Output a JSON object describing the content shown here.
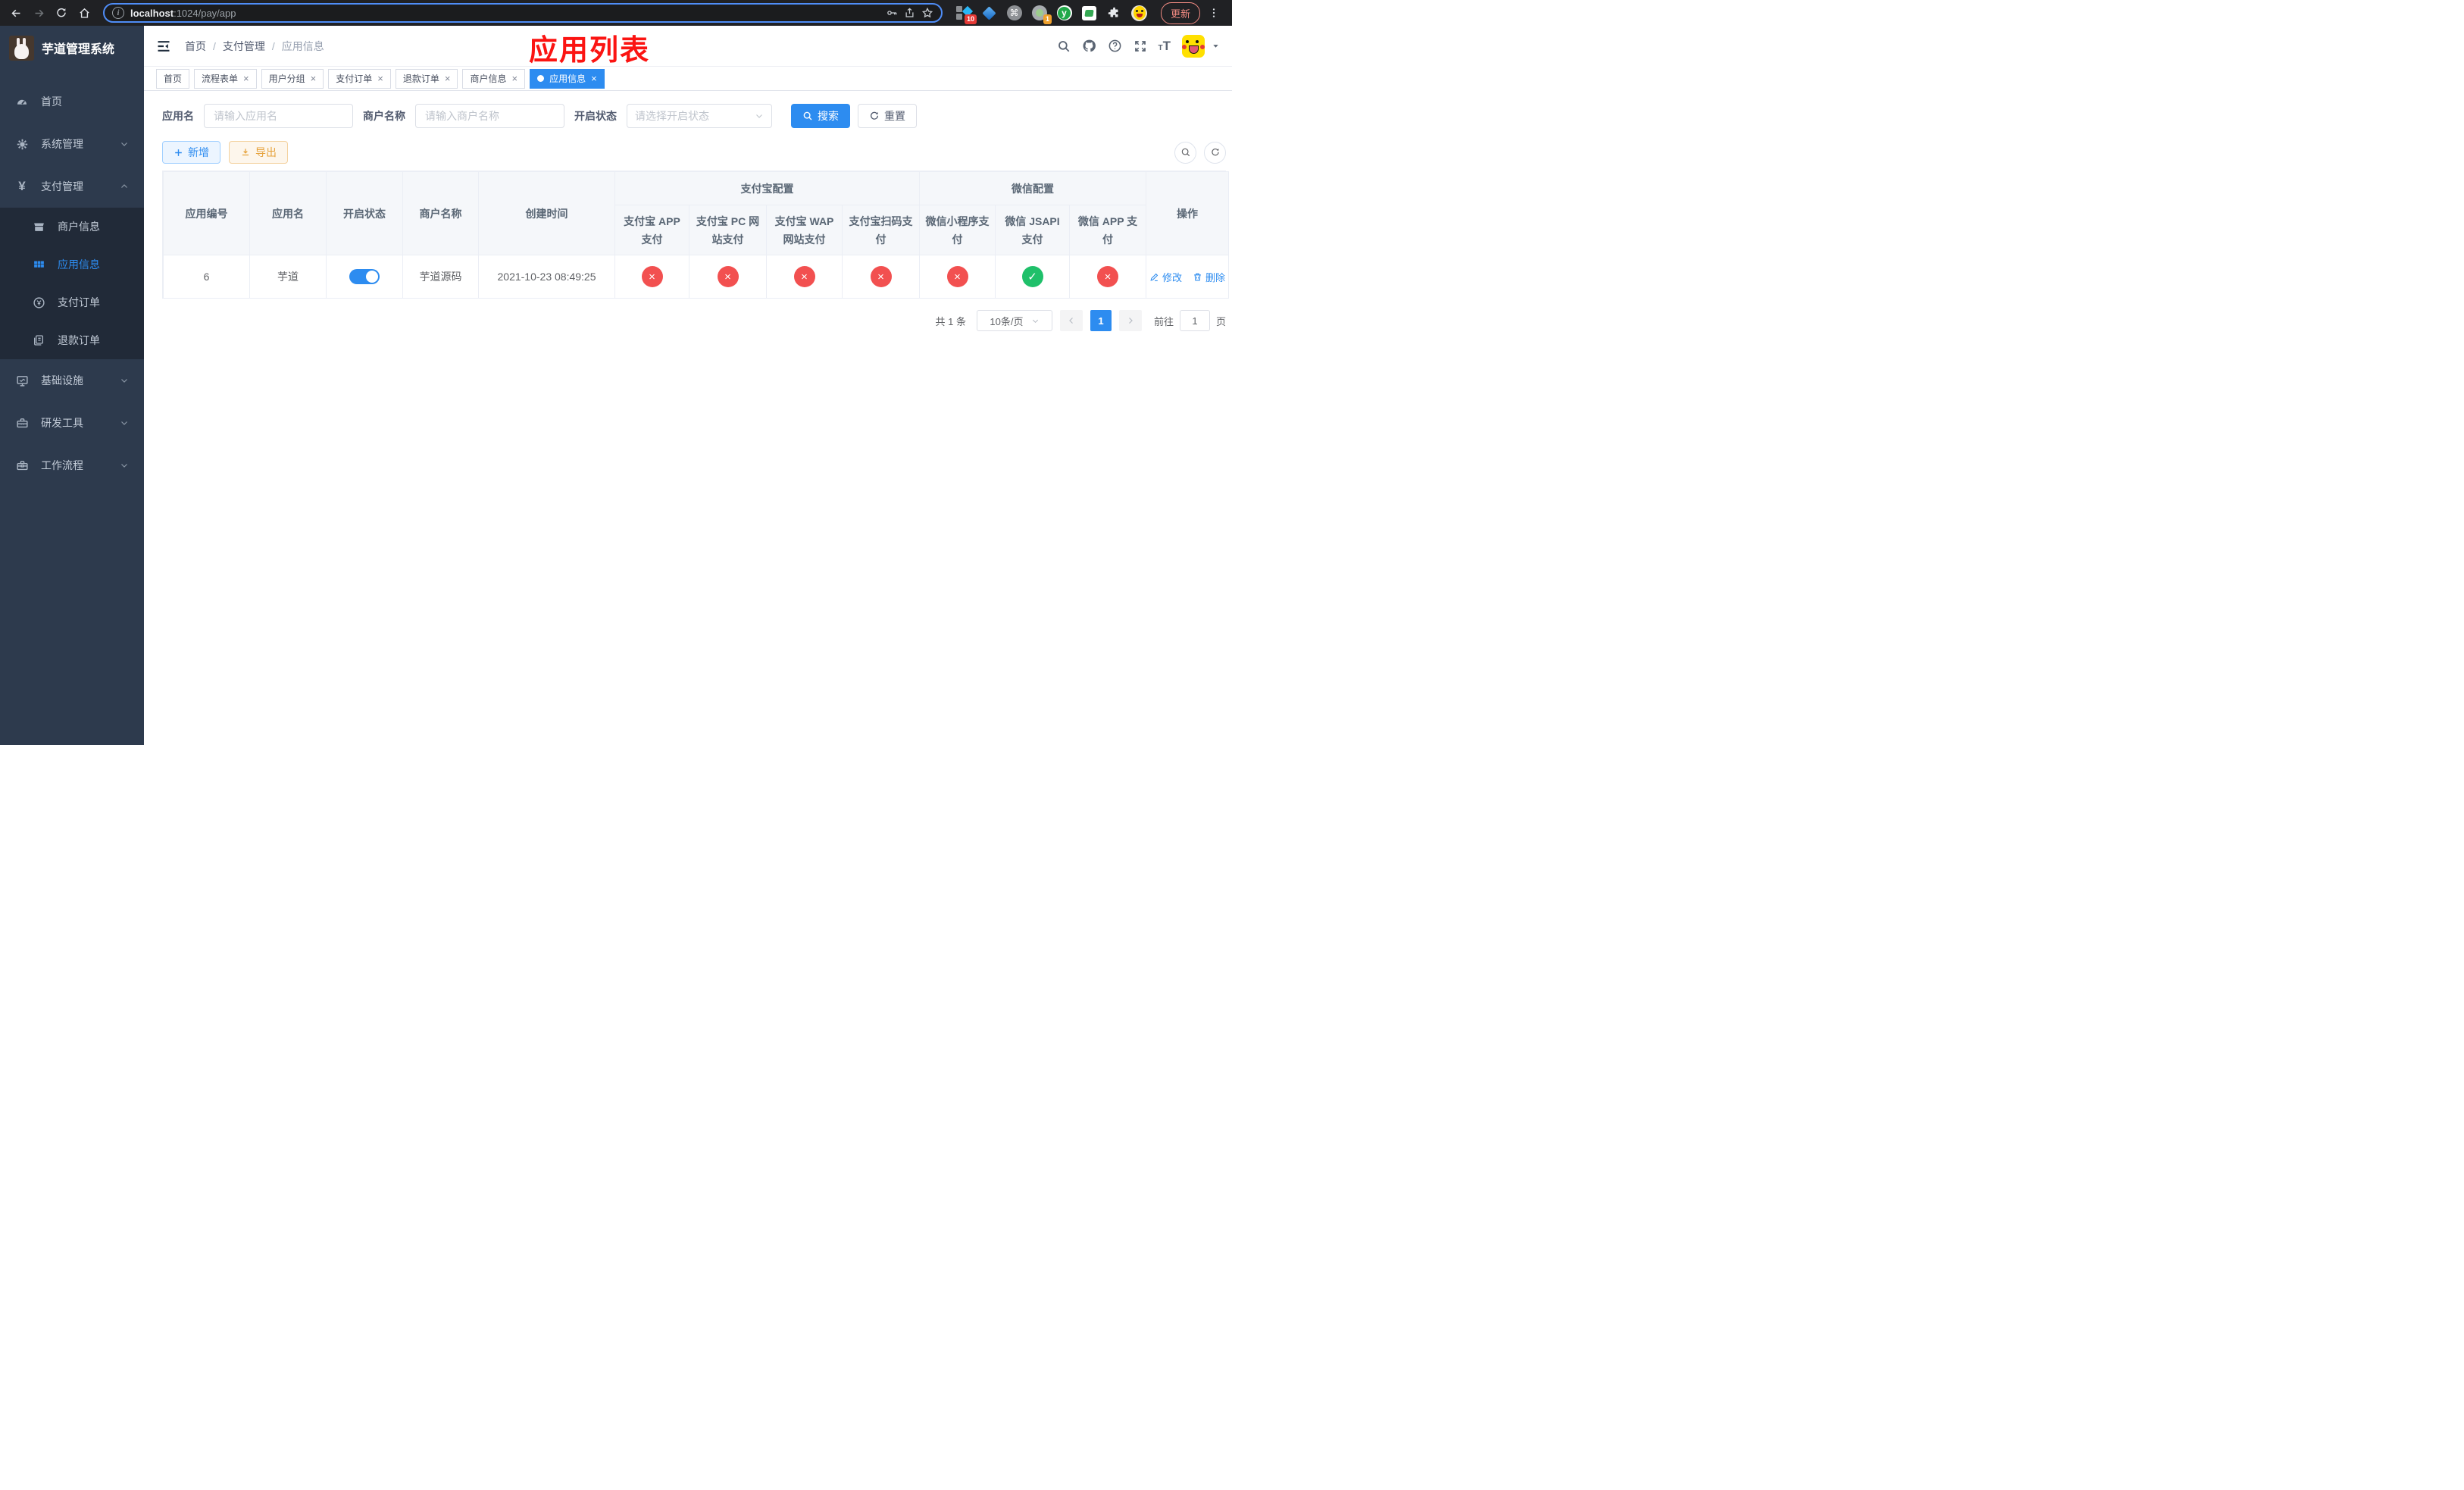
{
  "browser": {
    "url_host": "localhost",
    "url_rest": ":1024/pay/app",
    "update_label": "更新",
    "ext_badge_10": "10",
    "ext_badge_1": "1",
    "cmd_glyph": "⌘",
    "y_glyph": "y"
  },
  "sidebar": {
    "title": "芋道管理系统",
    "home": "首页",
    "system": "系统管理",
    "payment": "支付管理",
    "sub_merchant": "商户信息",
    "sub_app": "应用信息",
    "sub_order": "支付订单",
    "sub_refund": "退款订单",
    "infra": "基础设施",
    "devtools": "研发工具",
    "workflow": "工作流程",
    "payment_icon_glyph": "¥"
  },
  "header": {
    "breadcrumb": {
      "level1": "首页",
      "level2": "支付管理",
      "current": "应用信息"
    },
    "annotation": "应用列表",
    "help_glyph": "?"
  },
  "tabs": [
    {
      "label": "首页",
      "closable": false
    },
    {
      "label": "流程表单",
      "closable": true
    },
    {
      "label": "用户分组",
      "closable": true
    },
    {
      "label": "支付订单",
      "closable": true
    },
    {
      "label": "退款订单",
      "closable": true
    },
    {
      "label": "商户信息",
      "closable": true
    },
    {
      "label": "应用信息",
      "closable": true,
      "active": true
    }
  ],
  "filters": {
    "app_name_label": "应用名",
    "app_name_placeholder": "请输入应用名",
    "merchant_label": "商户名称",
    "merchant_placeholder": "请输入商户名称",
    "status_label": "开启状态",
    "status_placeholder": "请选择开启状态",
    "search_label": "搜索",
    "reset_label": "重置"
  },
  "toolbar": {
    "add_label": "新增",
    "export_label": "导出"
  },
  "table": {
    "columns": {
      "app_id": "应用编号",
      "app_name": "应用名",
      "status": "开启状态",
      "merchant": "商户名称",
      "created": "创建时间",
      "alipay_group": "支付宝配置",
      "wechat_group": "微信配置",
      "ops": "操作",
      "channels": [
        "支付宝 APP 支付",
        "支付宝 PC 网站支付",
        "支付宝 WAP 网站支付",
        "支付宝扫码支付",
        "微信小程序支付",
        "微信 JSAPI 支付",
        "微信 APP 支付"
      ]
    },
    "rows": [
      {
        "app_id": "6",
        "app_name": "芋道",
        "enabled": true,
        "merchant": "芋道源码",
        "created": "2021-10-23 08:49:25",
        "statuses": [
          "no",
          "no",
          "no",
          "no",
          "no",
          "yes",
          "no"
        ],
        "edit_label": "修改",
        "delete_label": "删除"
      }
    ]
  },
  "pagination": {
    "total": "共 1 条",
    "page_size": "10条/页",
    "current_page": "1",
    "goto_label": "前往",
    "goto_value": "1",
    "page_unit": "页"
  },
  "colors": {
    "accent": "#2d8cf0",
    "success": "#1fc06a",
    "danger": "#f25050",
    "warning": "#e6a23c",
    "sidebar_bg": "#2d3a4d",
    "submenu_bg": "#212a38",
    "chrome_bg": "#202124",
    "annotation_red": "#fb1412"
  }
}
